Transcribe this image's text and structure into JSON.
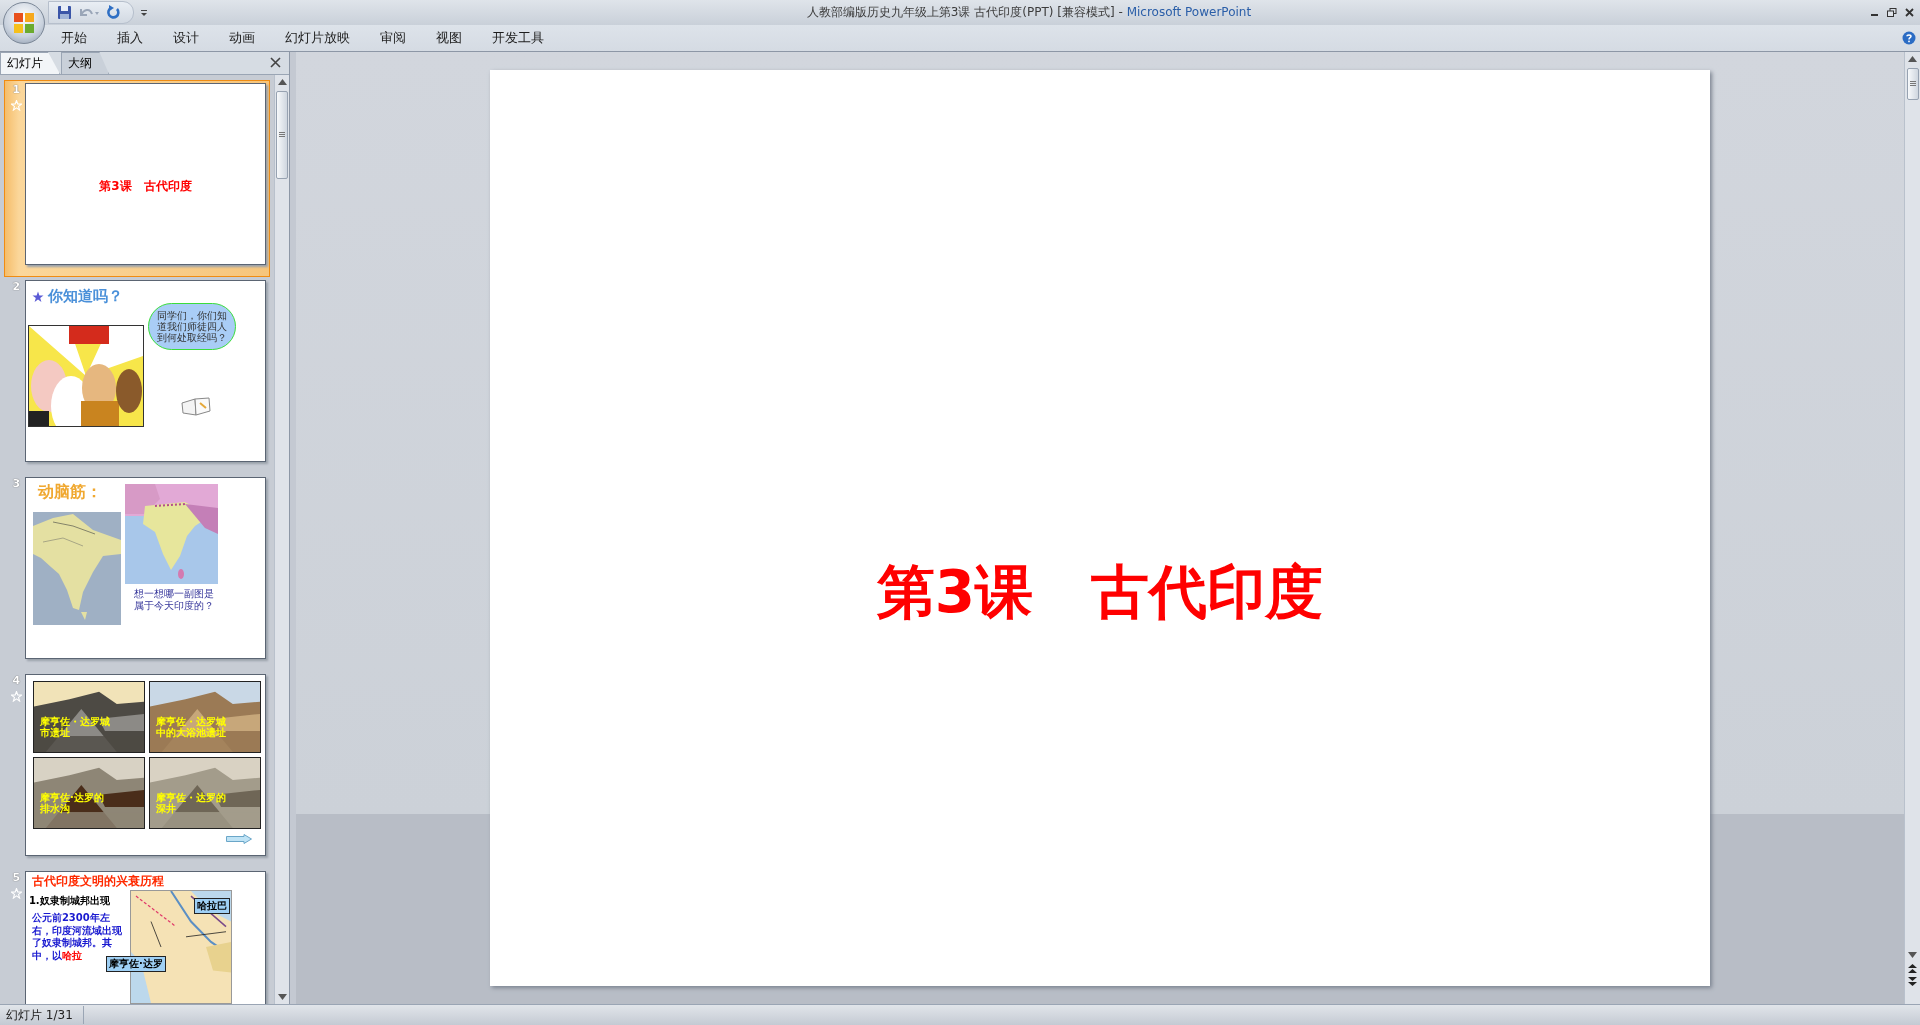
{
  "window": {
    "document_title": "人教部编版历史九年级上第3课 古代印度(PPT) [兼容模式]",
    "separator": "-",
    "app_name": "Microsoft PowerPoint"
  },
  "ribbon_tabs": [
    {
      "label": "开始",
      "selected": false
    },
    {
      "label": "插入",
      "selected": false
    },
    {
      "label": "设计",
      "selected": false
    },
    {
      "label": "动画",
      "selected": false
    },
    {
      "label": "幻灯片放映",
      "selected": false
    },
    {
      "label": "审阅",
      "selected": false
    },
    {
      "label": "视图",
      "selected": false
    },
    {
      "label": "开发工具",
      "selected": false
    }
  ],
  "pane_tabs": [
    {
      "label": "幻灯片",
      "selected": true
    },
    {
      "label": "大纲",
      "selected": false
    }
  ],
  "slides": [
    {
      "number": "1",
      "selected": true,
      "has_animation": true,
      "kind": "title",
      "title": "第3课　古代印度"
    },
    {
      "number": "2",
      "selected": false,
      "has_animation": false,
      "kind": "question",
      "title": "你知道吗？",
      "bubble": "同学们，你们知道我们师徒四人到何处取经吗？"
    },
    {
      "number": "3",
      "selected": false,
      "has_animation": false,
      "kind": "maps",
      "title": "动脑筋：",
      "question": "想一想哪一副图是属于今天印度的？"
    },
    {
      "number": "4",
      "selected": false,
      "has_animation": true,
      "kind": "photos",
      "captions": [
        "摩亨佐・达罗城市遗址",
        "摩亨佐・达罗城中的大浴池遗址",
        "摩亨佐·达罗的排水沟",
        "摩亨佐・达罗的深井"
      ]
    },
    {
      "number": "5",
      "selected": false,
      "has_animation": true,
      "kind": "history",
      "title": "古代印度文明的兴衰历程",
      "subtitle": "1.奴隶制城邦出现",
      "body": "公元前2300年左右，印度河流域出现了奴隶制城邦。其中，以",
      "body_highlight": "哈拉",
      "labels": [
        "哈拉巴",
        "摩亨佐·达罗"
      ]
    }
  ],
  "slide": {
    "title": "第3课　古代印度"
  },
  "status_bar": {
    "slide_info": "幻灯片 1/31"
  }
}
